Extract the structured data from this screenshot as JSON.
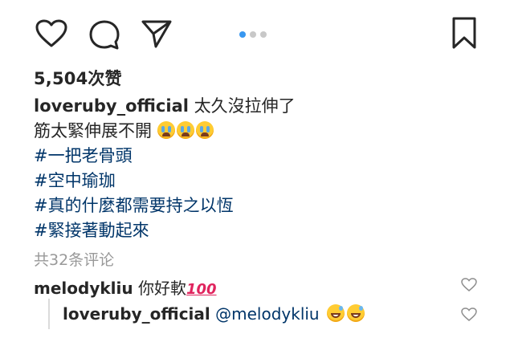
{
  "actions": {
    "like_icon": "heart-outline",
    "comment_icon": "speech-bubble",
    "share_icon": "paper-plane",
    "save_icon": "bookmark-outline"
  },
  "carousel": {
    "total": 3,
    "active_index": 0
  },
  "likes": "5,504次赞",
  "caption": {
    "username": "loveruby_official",
    "line1": "太久沒拉伸了",
    "line2": "筋太緊伸展不開",
    "emoji": "loudly-crying-face",
    "hashtags": [
      "#一把老骨頭",
      "#空中瑜珈",
      "#真的什麼都需要持之以恆",
      "#緊接著動起來"
    ]
  },
  "comments_count": "共32条评论",
  "comment": {
    "username": "melodykliu",
    "text": "你好軟",
    "emoji_text": "100"
  },
  "reply": {
    "username": "loveruby_official",
    "mention": "@melodykliu",
    "emoji": "grinning-face-with-sweat"
  },
  "colors": {
    "link": "#003569",
    "muted": "#999999",
    "active_dot": "#3897f0",
    "text": "#262626"
  }
}
